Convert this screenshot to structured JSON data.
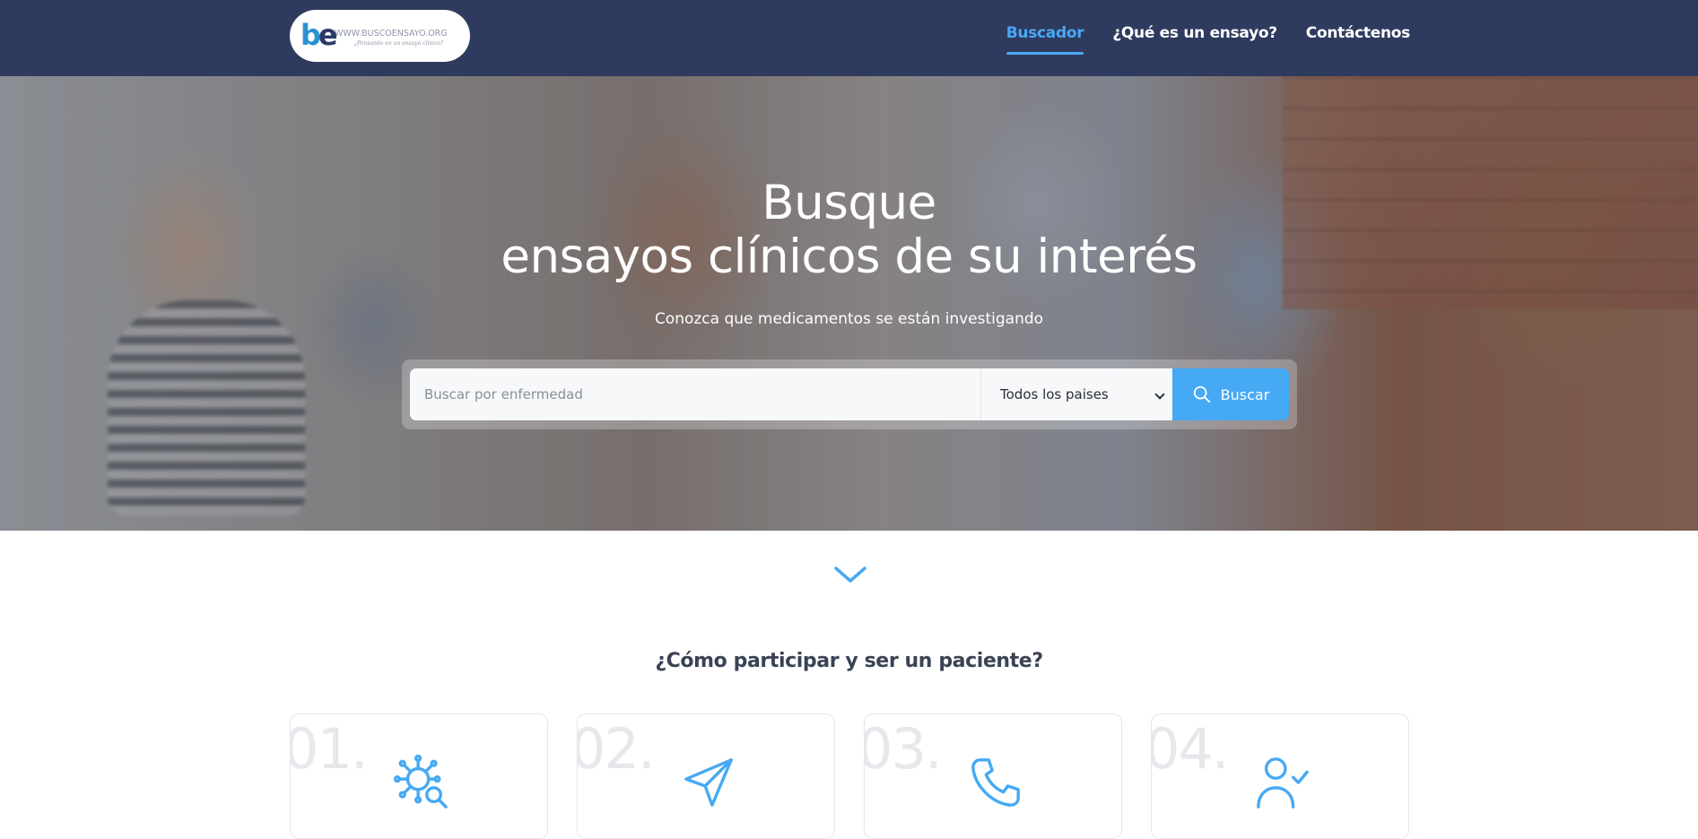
{
  "navbar": {
    "logo": {
      "mark_b": "b",
      "mark_e": "e",
      "url": "WWW.BUSCOENSAYO.ORG",
      "tagline": "¿Pensando en un ensayo clínico?"
    },
    "links": [
      {
        "label": "Buscador",
        "active": true
      },
      {
        "label": "¿Qué es un ensayo?",
        "active": false
      },
      {
        "label": "Contáctenos",
        "active": false
      }
    ]
  },
  "hero": {
    "title_line1": "Busque",
    "title_line2": "ensayos clínicos de su interés",
    "subtitle": "Conozca que medicamentos se están investigando",
    "search": {
      "placeholder": "Buscar por enfermedad",
      "value": "",
      "country_selected": "Todos los paises",
      "button_label": "Buscar"
    }
  },
  "how": {
    "title": "¿Cómo participar y ser un paciente?",
    "steps": [
      {
        "num": "01.",
        "icon": "virus-search-icon"
      },
      {
        "num": "02.",
        "icon": "paper-plane-icon"
      },
      {
        "num": "03.",
        "icon": "phone-icon"
      },
      {
        "num": "04.",
        "icon": "user-check-icon"
      }
    ]
  },
  "colors": {
    "navbar_bg": "#2f3b5e",
    "accent": "#46a9f3",
    "nav_active": "#4aa8f5",
    "heading_text": "#3a4355"
  }
}
